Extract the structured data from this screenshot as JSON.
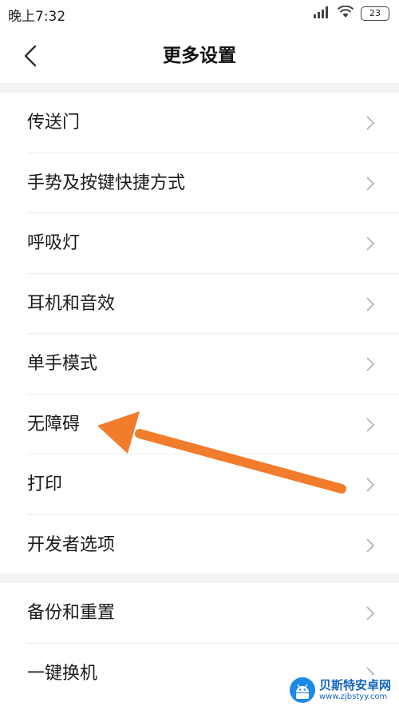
{
  "status_bar": {
    "time": "晚上7:32",
    "battery": "23"
  },
  "header": {
    "title": "更多设置",
    "back_icon": "chevron-left-icon"
  },
  "sections": [
    {
      "items": [
        {
          "label": "传送门"
        },
        {
          "label": "手势及按键快捷方式"
        },
        {
          "label": "呼吸灯"
        },
        {
          "label": "耳机和音效"
        },
        {
          "label": "单手模式"
        },
        {
          "label": "无障碍"
        },
        {
          "label": "打印"
        },
        {
          "label": "开发者选项"
        }
      ]
    },
    {
      "items": [
        {
          "label": "备份和重置"
        },
        {
          "label": "一键换机"
        }
      ]
    }
  ],
  "annotation": {
    "arrow_color": "#f07c2c"
  },
  "watermark": {
    "name": "贝斯特安卓网",
    "url": "www.zjbstyy.com"
  }
}
